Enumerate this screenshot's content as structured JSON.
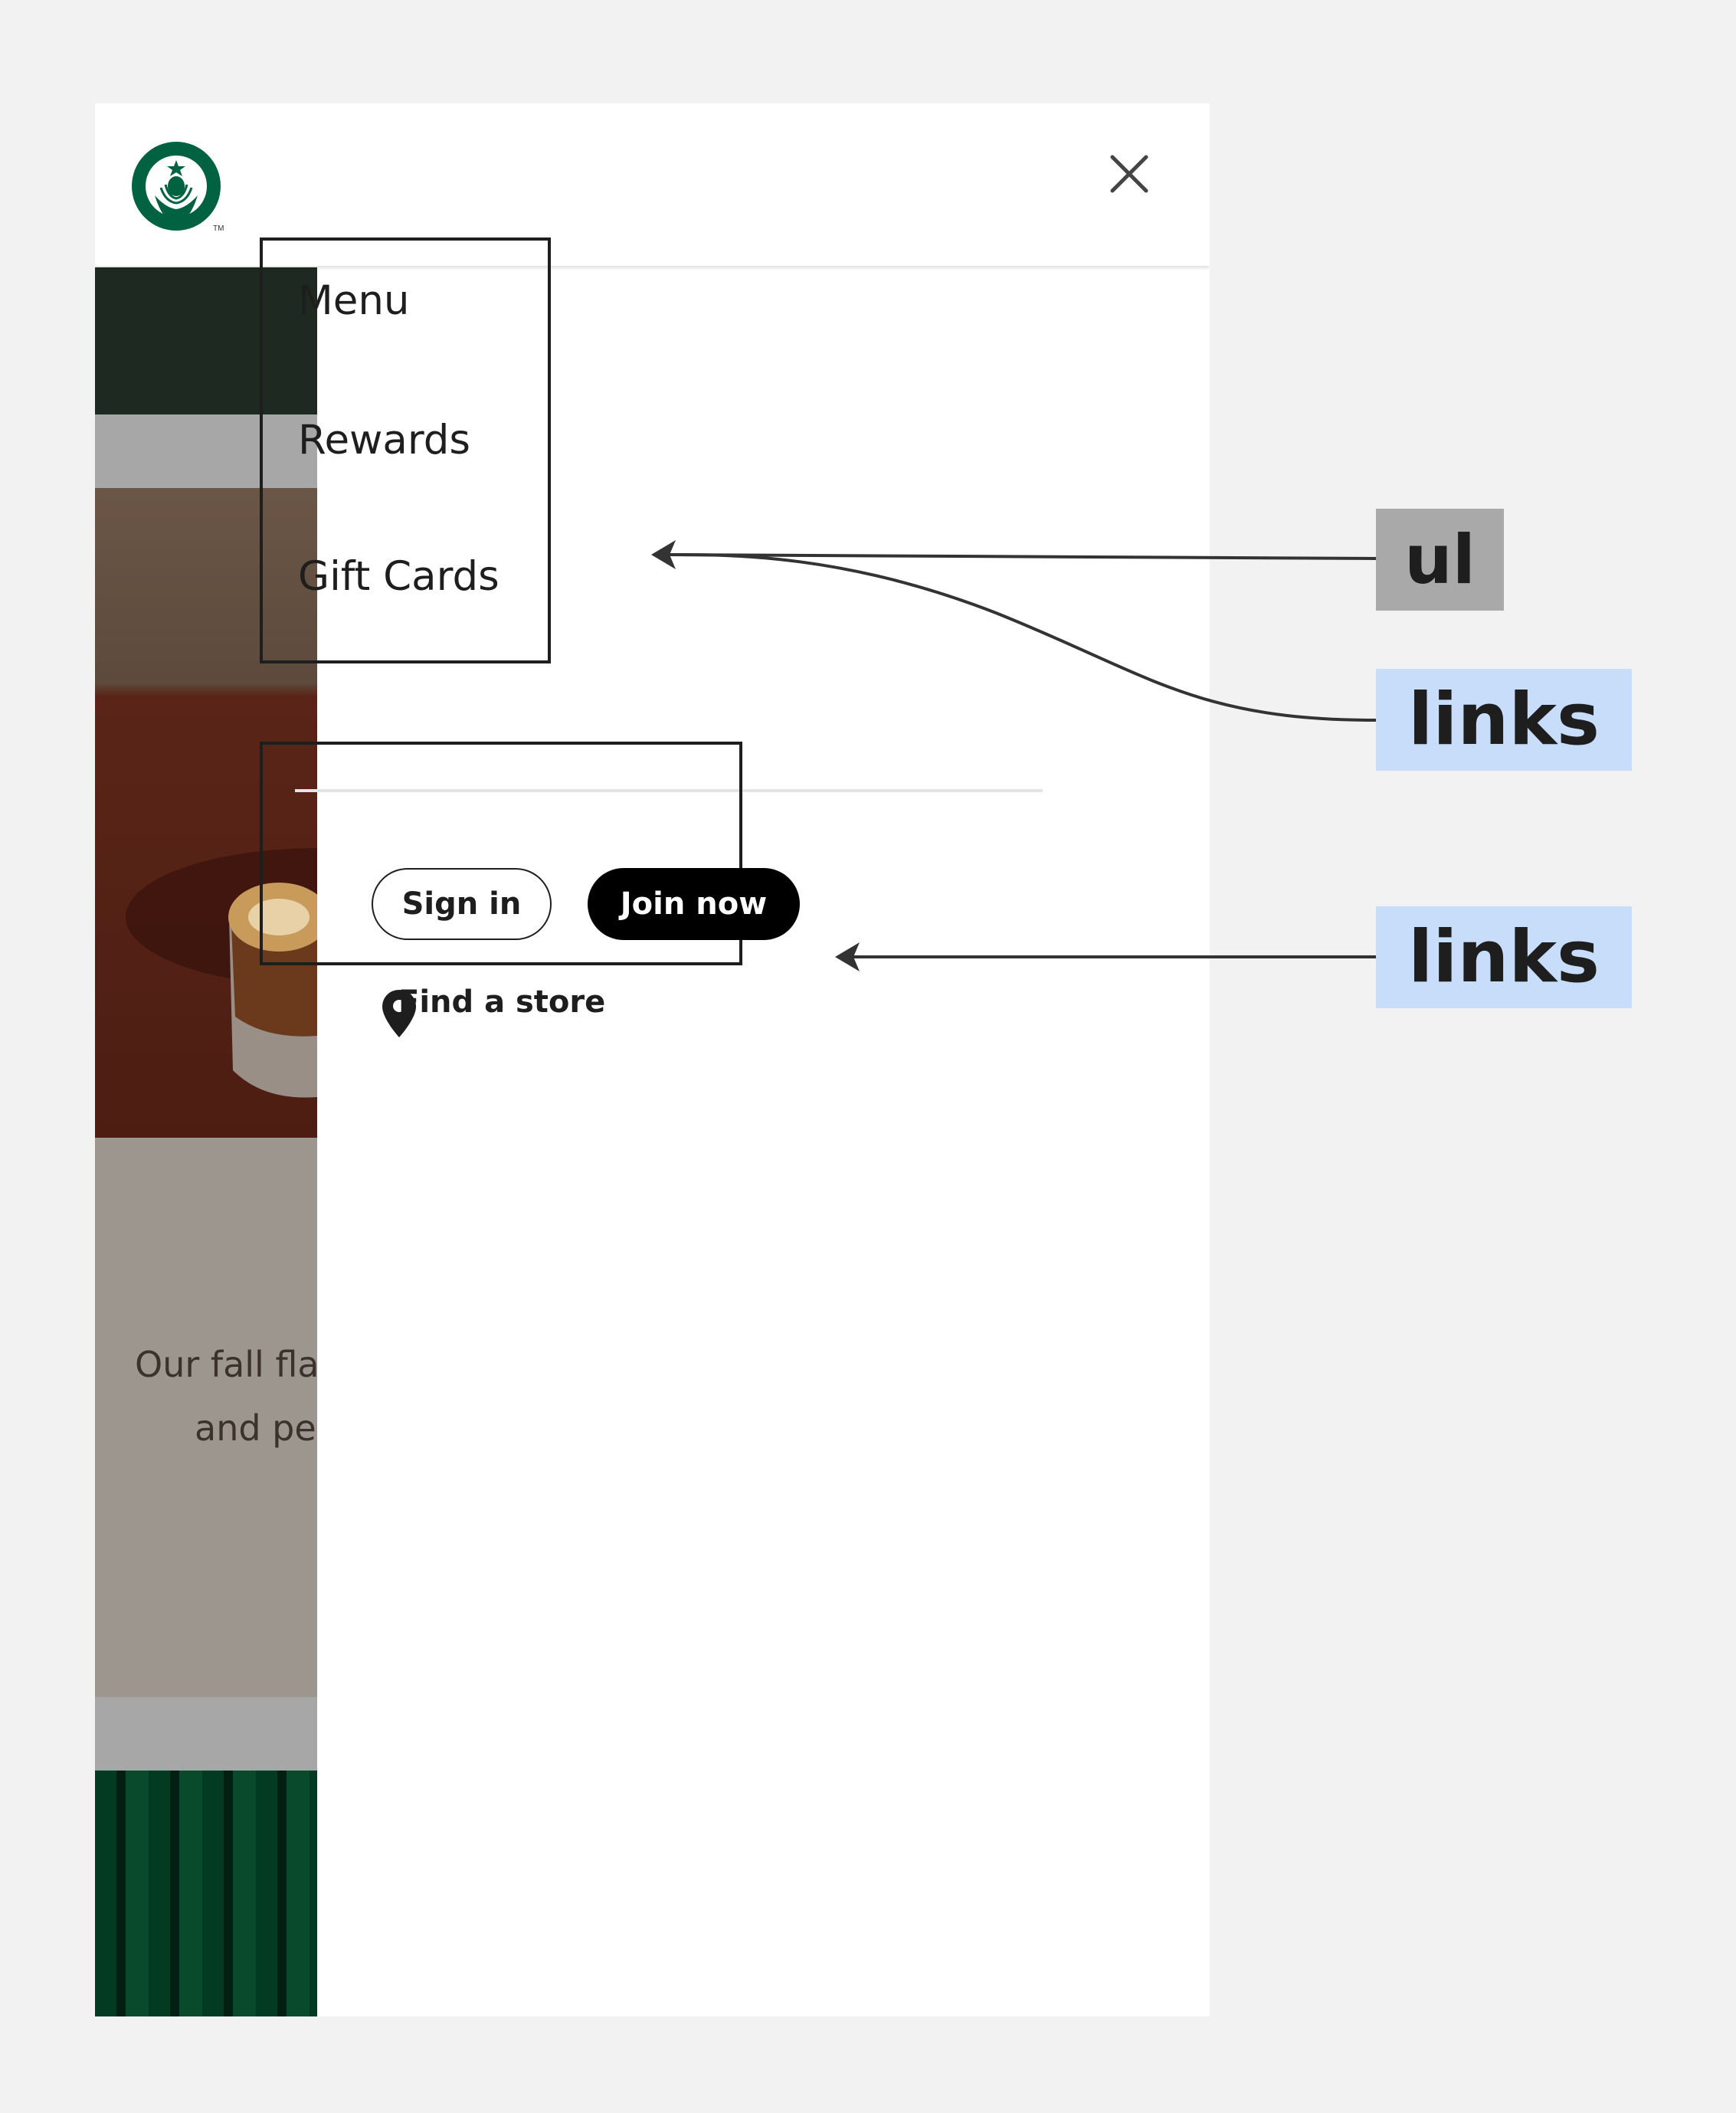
{
  "nav": {
    "items": [
      {
        "label": "Menu"
      },
      {
        "label": "Rewards"
      },
      {
        "label": "Gift Cards"
      }
    ]
  },
  "account": {
    "sign_in_label": "Sign in",
    "join_now_label": "Join now",
    "find_store_label": "Find a store"
  },
  "background_page": {
    "tagline_line1": "Our fall flav",
    "tagline_line2": "and pe"
  },
  "annotations": {
    "ul_label": "ul",
    "links_label_1": "links",
    "links_label_2": "links"
  },
  "colors": {
    "brand_green": "#006241",
    "join_button": "#000000",
    "annotation_gray": "#a9a9a9",
    "annotation_blue": "#c8ddfa"
  },
  "icons": {
    "logo": "starbucks-siren-logo",
    "close": "close-icon",
    "store": "location-pin-icon"
  }
}
